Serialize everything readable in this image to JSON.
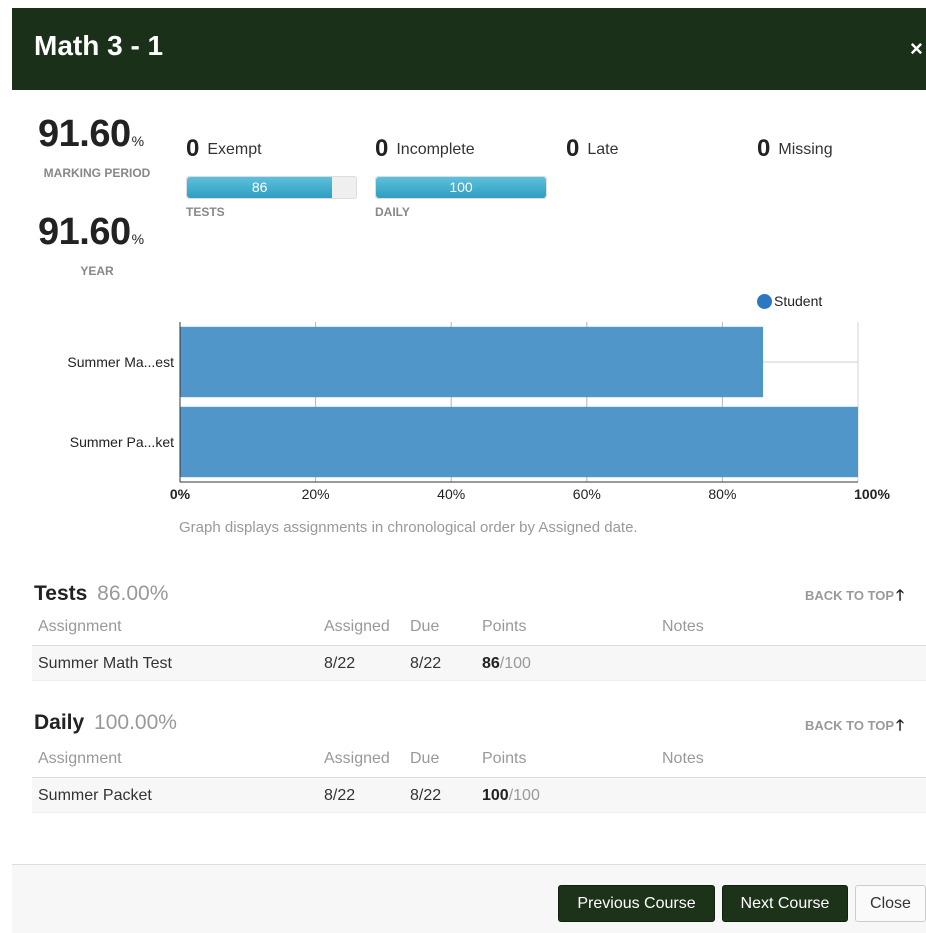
{
  "header": {
    "title": "Math 3 - 1",
    "close_icon": "×"
  },
  "grades": {
    "marking_period": {
      "value": "91.60",
      "unit": "%",
      "label": "Marking Period"
    },
    "year": {
      "value": "91.60",
      "unit": "%",
      "label": "Year"
    }
  },
  "stats": [
    {
      "count": "0",
      "label": "Exempt"
    },
    {
      "count": "0",
      "label": "Incomplete"
    },
    {
      "count": "0",
      "label": "Late"
    },
    {
      "count": "0",
      "label": "Missing"
    }
  ],
  "category_bars": [
    {
      "label": "TESTS",
      "value_text": "86",
      "value": 86
    },
    {
      "label": "DAILY",
      "value_text": "100",
      "value": 100
    }
  ],
  "chart_data": {
    "type": "bar",
    "orientation": "horizontal",
    "categories": [
      "Summer Ma...est",
      "Summer Pa...ket"
    ],
    "series": [
      {
        "name": "Student",
        "values": [
          86,
          100
        ],
        "color": "#5196c9"
      }
    ],
    "xlim": [
      0,
      100
    ],
    "x_ticks": [
      "0%",
      "20%",
      "40%",
      "60%",
      "80%",
      "100%"
    ],
    "legend_position": "top-right",
    "grid": true
  },
  "chart_note": "Graph displays assignments in chronological order by Assigned date.",
  "sections": [
    {
      "title": "Tests",
      "percent": "86.00%",
      "back_to_top": "BACK TO TOP",
      "columns": {
        "assignment": "Assignment",
        "assigned": "Assigned",
        "due": "Due",
        "points": "Points",
        "notes": "Notes"
      },
      "rows": [
        {
          "assignment": "Summer Math Test",
          "assigned": "8/22",
          "due": "8/22",
          "earned": "86",
          "total": "/100",
          "notes": ""
        }
      ]
    },
    {
      "title": "Daily",
      "percent": "100.00%",
      "back_to_top": "BACK TO TOP",
      "columns": {
        "assignment": "Assignment",
        "assigned": "Assigned",
        "due": "Due",
        "points": "Points",
        "notes": "Notes"
      },
      "rows": [
        {
          "assignment": "Summer Packet",
          "assigned": "8/22",
          "due": "8/22",
          "earned": "100",
          "total": "/100",
          "notes": ""
        }
      ]
    }
  ],
  "footer": {
    "previous_label": "Previous Course",
    "next_label": "Next Course",
    "close_label": "Close"
  },
  "colors": {
    "header_bg": "#1b3019",
    "bar_blue": "#2e9ec1",
    "chart_blue": "#5196c9",
    "legend_dot": "#2b78c2"
  }
}
